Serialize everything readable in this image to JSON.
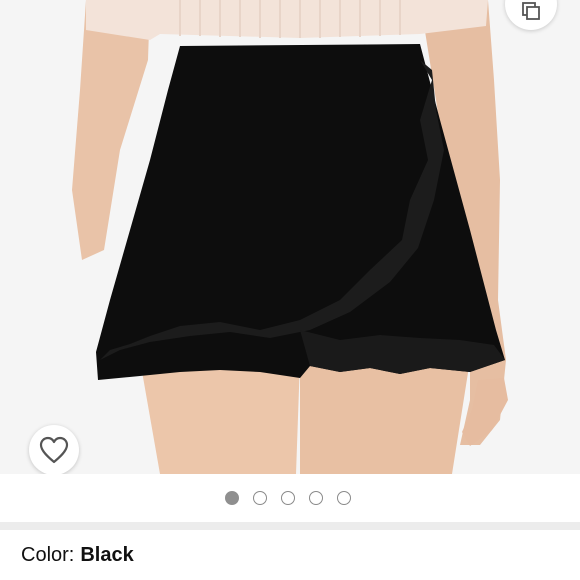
{
  "product": {
    "image_description_icon": "product-photo",
    "color_label": "Color:",
    "color_value": "Black"
  },
  "carousel": {
    "total": 5,
    "active_index": 0
  },
  "icons": {
    "wishlist": "heart-outline-icon",
    "share": "share-icon"
  },
  "colors": {
    "skirt": "#0d0d0d",
    "active_dot": "#8f8f8f"
  }
}
